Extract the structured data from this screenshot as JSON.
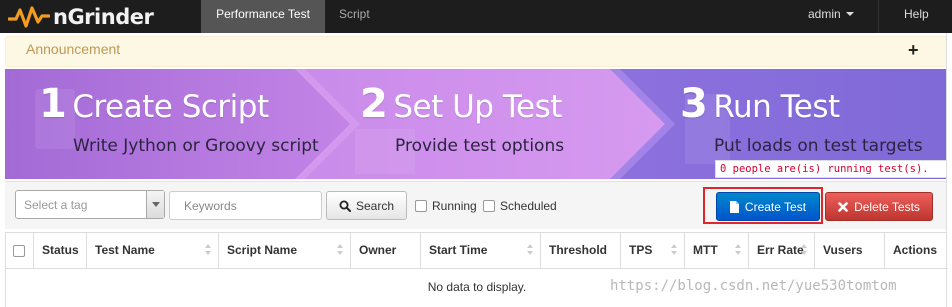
{
  "navbar": {
    "brand": "nGrinder",
    "tabs": [
      {
        "label": "Performance Test",
        "active": true
      },
      {
        "label": "Script",
        "active": false
      }
    ],
    "user": "admin",
    "help": "Help"
  },
  "announcement": {
    "label": "Announcement",
    "toggle": "+"
  },
  "banner": {
    "steps": [
      {
        "number": "1",
        "title": "Create Script",
        "desc": "Write Jython or Groovy script"
      },
      {
        "number": "2",
        "title": "Set Up Test",
        "desc": "Provide test options"
      },
      {
        "number": "3",
        "title": "Run Test",
        "desc": "Put loads on test targets"
      }
    ],
    "running_message": "0 people are(is) running test(s)."
  },
  "toolbar": {
    "tag_placeholder": "Select a tag",
    "keyword_placeholder": "Keywords",
    "search_label": "Search",
    "running_label": "Running",
    "scheduled_label": "Scheduled",
    "create_label": "Create Test",
    "delete_label": "Delete Tests"
  },
  "table": {
    "columns": [
      "Status",
      "Test Name",
      "Script Name",
      "Owner",
      "Start Time",
      "Threshold",
      "TPS",
      "MTT",
      "Err Rate",
      "Vusers",
      "Actions"
    ],
    "empty_message": "No data to display."
  },
  "watermark": "https://blog.csdn.net/yue530tomtom",
  "colors": {
    "navbar_bg": "#1d1d1d",
    "active_tab_bg": "#555555",
    "brand_orange": "#f39c1e",
    "create_button": "#006dcc",
    "delete_button": "#da4f49",
    "highlight_outline": "#e0262b",
    "running_message": "#d8002e"
  },
  "icons": {
    "brand": "pulse-logo-icon",
    "search": "magnifier-icon",
    "create": "document-icon",
    "delete": "x-icon",
    "announcement_toggle": "plus-icon"
  }
}
